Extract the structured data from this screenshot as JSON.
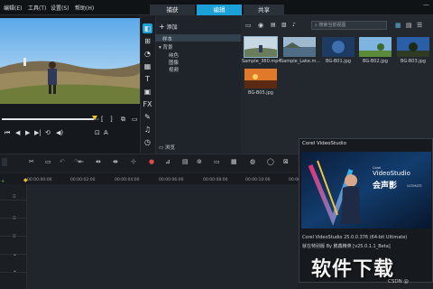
{
  "menu": [
    "编辑(E)",
    "工具(T)",
    "设置(S)",
    "帮助(H)"
  ],
  "tabs": [
    {
      "label": "捕获",
      "active": false
    },
    {
      "label": "编辑",
      "active": true
    },
    {
      "label": "共享",
      "active": false
    }
  ],
  "player": {
    "icons": [
      "prev-icon",
      "rewind-icon",
      "play-icon",
      "step-forward-icon",
      "repeat-icon",
      "volume-icon",
      "mark-in-icon",
      "mark-out-icon"
    ],
    "mini_icons": [
      "[",
      "]",
      "⧉",
      "▭"
    ],
    "progress": 0.94
  },
  "library": {
    "add_label": "添加",
    "tree": [
      "样本",
      "背景",
      "纯色",
      "图像",
      "视频"
    ],
    "selected": "样本",
    "browse_label": "浏览"
  },
  "media": {
    "search_placeholder": "搜索当前视图",
    "items": [
      {
        "label": "Sample_360.mp4",
        "selected": true
      },
      {
        "label": "Sample_Lake.m..."
      },
      {
        "label": "BG-B01.jpg"
      },
      {
        "label": "BG-B02.jpg"
      },
      {
        "label": "BG-B03.jpg"
      },
      {
        "label": "BG-B05.jpg"
      }
    ]
  },
  "timeline": {
    "ticks": [
      "00:00:00:00",
      "00:00:02:00",
      "00:00:04:00",
      "00:00:06:00",
      "00:00:08:00",
      "00:00:10:00",
      "00:00:12:00"
    ]
  },
  "about": {
    "title": "Corel VideoStudio",
    "product_line1": "VideoStudio",
    "product_line2": "会声影",
    "edition": "ULTIMATE",
    "brand": "Corel",
    "version_text": "Corel VideoStudio 25.0.0.376  (64-bit Ultimate)",
    "build_text": "就在特别版 By 鹏鑫精英 [v25.0.1.1_Beta]"
  },
  "watermark": "软件下载",
  "credit": "CSDN @"
}
